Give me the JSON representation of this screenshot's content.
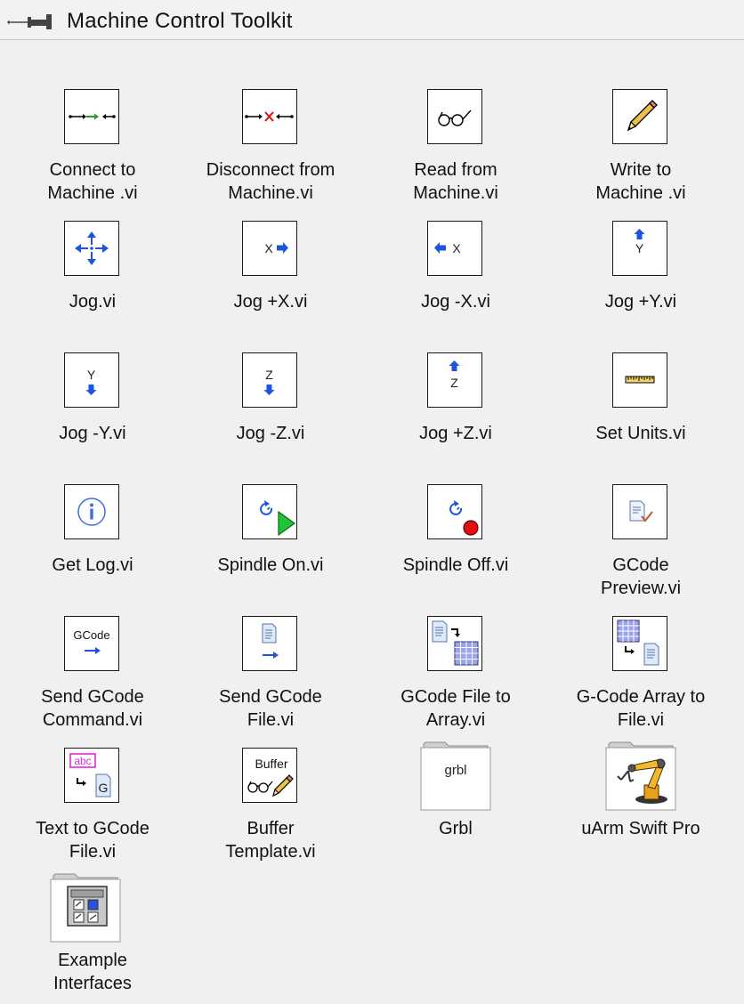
{
  "palette": {
    "title": "Machine Control Toolkit",
    "items": [
      {
        "label": "Connect to\nMachine .vi",
        "icon": "connect-icon"
      },
      {
        "label": "Disconnect from\nMachine.vi",
        "icon": "disconnect-icon"
      },
      {
        "label": "Read from\nMachine.vi",
        "icon": "glasses-icon"
      },
      {
        "label": "Write to\nMachine .vi",
        "icon": "pencil-icon"
      },
      {
        "label": "Jog.vi",
        "icon": "jog-arrows-icon"
      },
      {
        "label": "Jog +X.vi",
        "icon": "jog-plus-x-icon",
        "glyph": "X"
      },
      {
        "label": "Jog -X.vi",
        "icon": "jog-minus-x-icon",
        "glyph": "X"
      },
      {
        "label": "Jog +Y.vi",
        "icon": "jog-plus-y-icon",
        "glyph": "Y"
      },
      {
        "label": "Jog -Y.vi",
        "icon": "jog-minus-y-icon",
        "glyph": "Y"
      },
      {
        "label": "Jog -Z.vi",
        "icon": "jog-minus-z-icon",
        "glyph": "Z"
      },
      {
        "label": "Jog +Z.vi",
        "icon": "jog-plus-z-icon",
        "glyph": "Z"
      },
      {
        "label": "Set Units.vi",
        "icon": "ruler-icon"
      },
      {
        "label": "Get Log.vi",
        "icon": "info-icon"
      },
      {
        "label": "Spindle On.vi",
        "icon": "spindle-on-icon"
      },
      {
        "label": "Spindle Off.vi",
        "icon": "spindle-off-icon"
      },
      {
        "label": "GCode\nPreview.vi",
        "icon": "preview-icon"
      },
      {
        "label": "Send GCode\nCommand.vi",
        "icon": "send-command-icon",
        "glyph": "GCode"
      },
      {
        "label": "Send GCode\nFile.vi",
        "icon": "send-file-icon"
      },
      {
        "label": "GCode File to\nArray.vi",
        "icon": "file-to-array-icon"
      },
      {
        "label": "G-Code Array to\nFile.vi",
        "icon": "array-to-file-icon"
      },
      {
        "label": "Text to GCode\nFile.vi",
        "icon": "text-to-file-icon",
        "glyph": "abc",
        "glyph2": "G"
      },
      {
        "label": "Buffer\nTemplate.vi",
        "icon": "buffer-icon",
        "glyph": "Buffer"
      },
      {
        "label": "Grbl",
        "icon": "grbl-folder-icon",
        "glyph": "grbl"
      },
      {
        "label": "uArm Swift Pro",
        "icon": "robot-arm-folder-icon"
      },
      {
        "label": "Example\nInterfaces",
        "icon": "example-folder-icon"
      }
    ]
  }
}
